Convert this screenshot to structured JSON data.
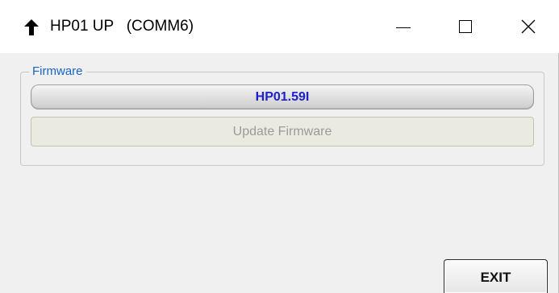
{
  "window": {
    "title": "HP01 UP   (COMM6)",
    "icon": "up-arrow-icon",
    "controls": [
      "minimize",
      "maximize",
      "close"
    ]
  },
  "firmware_group": {
    "label": "Firmware",
    "version": "HP01.59I",
    "update_button_label": "Update Firmware",
    "update_button_enabled": false
  },
  "footer": {
    "exit_label": "EXIT"
  },
  "colors": {
    "group_label": "#1a63c6",
    "version_text": "#1c22c7",
    "disabled_text": "#9a9a9a"
  }
}
